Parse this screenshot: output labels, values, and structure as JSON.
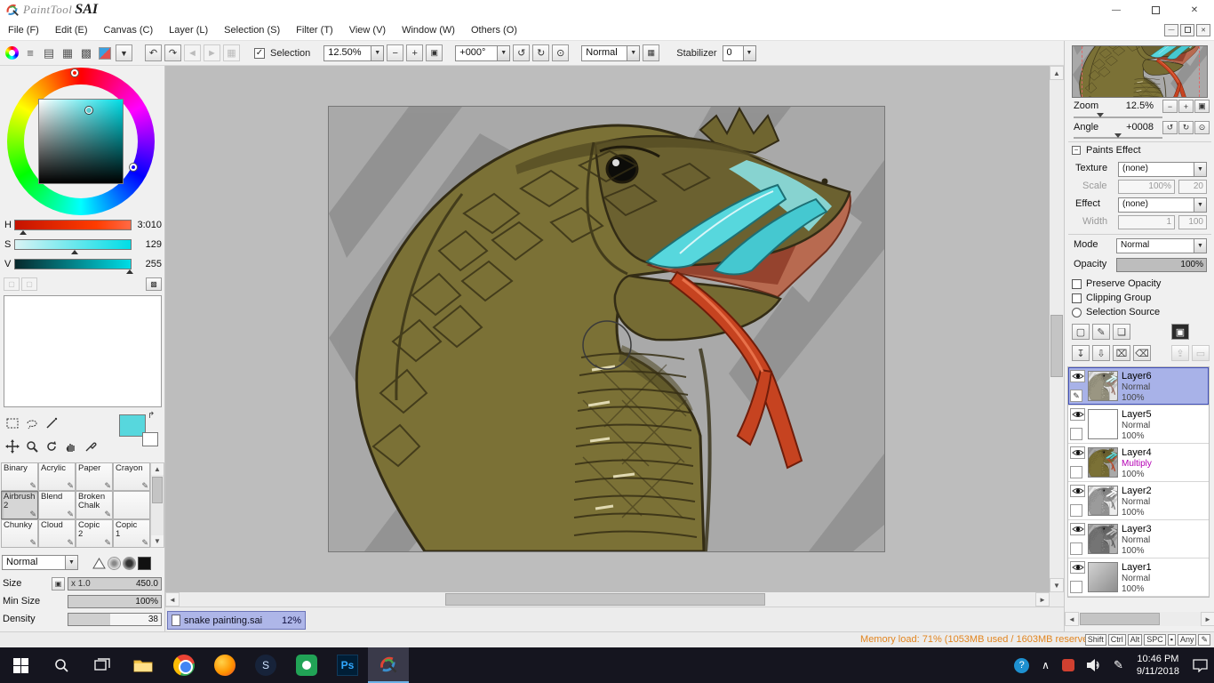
{
  "titlebar": {
    "brand": "PaintTool",
    "name": "SAI"
  },
  "window_controls": {
    "min": "—",
    "close": "✕"
  },
  "menu": {
    "items": [
      "File (F)",
      "Edit (E)",
      "Canvas (C)",
      "Layer (L)",
      "Selection (S)",
      "Filter (T)",
      "View (V)",
      "Window (W)",
      "Others (O)"
    ]
  },
  "toolbar": {
    "selection": "Selection",
    "zoom": "12.50%",
    "angle": "+000°",
    "mode": "Normal",
    "stabilizer_label": "Stabilizer",
    "stabilizer": "0"
  },
  "color": {
    "h_label": "H",
    "h_value": "3:010",
    "s_label": "S",
    "s_value": "129",
    "v_label": "V",
    "v_value": "255"
  },
  "brushes": {
    "items": [
      "Binary",
      "Acrylic",
      "Paper",
      "Crayon",
      "Airbrush\n2",
      "Blend",
      "Broken\nChalk",
      "Chunky",
      "Cloud",
      "Copic\n2",
      "Copic\n1"
    ]
  },
  "brush_settings": {
    "mode": "Normal",
    "size_label": "Size",
    "size_prefix": "x 1.0",
    "size_value": "450.0",
    "min_label": "Min Size",
    "min_value": "100%",
    "density_label": "Density",
    "density_value": "38"
  },
  "tab": {
    "name": "snake painting.sai",
    "zoom": "12%"
  },
  "status": {
    "memory": "Memory load: 71% (1053MB used / 1603MB reserved)",
    "keys": [
      "Shift",
      "Ctrl",
      "Alt",
      "SPC"
    ],
    "any": "Any"
  },
  "navigator": {
    "zoom_label": "Zoom",
    "zoom_value": "12.5%",
    "angle_label": "Angle",
    "angle_value": "+0008"
  },
  "paints": {
    "header": "Paints Effect",
    "texture_label": "Texture",
    "texture_value": "(none)",
    "scale_label": "Scale",
    "scale_value": "100%",
    "scale_num": "20",
    "effect_label": "Effect",
    "effect_value": "(none)",
    "width_label": "Width",
    "width_value": "1",
    "width_num": "100"
  },
  "layerpanel": {
    "mode_label": "Mode",
    "mode_value": "Normal",
    "opacity_label": "Opacity",
    "opacity_value": "100%",
    "check1": "Preserve Opacity",
    "check2": "Clipping Group",
    "check3": "Selection Source",
    "layers": [
      {
        "name": "Layer6",
        "mode": "Normal",
        "opacity": "100%"
      },
      {
        "name": "Layer5",
        "mode": "Normal",
        "opacity": "100%"
      },
      {
        "name": "Layer4",
        "mode": "Multiply",
        "opacity": "100%"
      },
      {
        "name": "Layer2",
        "mode": "Normal",
        "opacity": "100%"
      },
      {
        "name": "Layer3",
        "mode": "Normal",
        "opacity": "100%"
      },
      {
        "name": "Layer1",
        "mode": "Normal",
        "opacity": "100%"
      }
    ]
  },
  "taskbar": {
    "time": "10:46 PM",
    "date": "9/11/2018",
    "ps": "Ps",
    "steam": "S",
    "help": "?"
  },
  "icons": {
    "dropdown": "▼",
    "up": "▲",
    "down": "▼",
    "left": "◄",
    "right": "►",
    "check": "✓",
    "minus": "−",
    "plus": "+",
    "fit": "▣",
    "undo": "↶",
    "redo": "↷",
    "rotccw": "↺",
    "rotcw": "↻",
    "rotreset": "⊙",
    "menu_lines": "≡",
    "grid1": "▤",
    "grid2": "▦",
    "grid3": "▩",
    "pencil": "✎",
    "swap": "↱",
    "collapse": "−",
    "new_layer": "▢",
    "new_folder": "❏",
    "transfer_down": "↧",
    "merge_down": "⇩",
    "clear_layer": "⌧",
    "delete_layer": "⌫",
    "lock": "⇪",
    "mask_extra": "▭",
    "chevron_up": "∧",
    "key_icon": "▪"
  },
  "colors": {
    "primary_swatch": "#57d7dd",
    "selected_layer": "#a8b2e8",
    "tab_highlight": "#aeb6e8",
    "memory_text": "#e2851f",
    "multiply_mode": "#b400b4"
  }
}
